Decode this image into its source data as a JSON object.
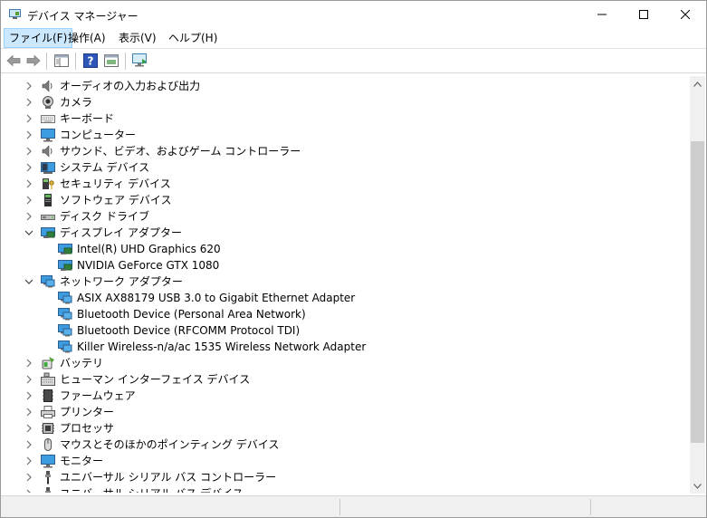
{
  "window": {
    "title": "デバイス マネージャー",
    "minimize_glyph": "—",
    "maximize_glyph": "☐",
    "close_glyph": "✕"
  },
  "menu": [
    {
      "label": "ファイル(F)"
    },
    {
      "label": "操作(A)"
    },
    {
      "label": "表示(V)"
    },
    {
      "label": "ヘルプ(H)"
    }
  ],
  "tree": [
    {
      "label": "オーディオの入力および出力",
      "icon": "speaker-icon",
      "expanded": false,
      "level": 0
    },
    {
      "label": "カメラ",
      "icon": "camera-icon",
      "expanded": false,
      "level": 0
    },
    {
      "label": "キーボード",
      "icon": "keyboard-icon",
      "expanded": false,
      "level": 0
    },
    {
      "label": "コンピューター",
      "icon": "monitor-icon",
      "expanded": false,
      "level": 0
    },
    {
      "label": "サウンド、ビデオ、およびゲーム コントローラー",
      "icon": "speaker-icon",
      "expanded": false,
      "level": 0
    },
    {
      "label": "システム デバイス",
      "icon": "system-device-icon",
      "expanded": false,
      "level": 0
    },
    {
      "label": "セキュリティ デバイス",
      "icon": "security-device-icon",
      "expanded": false,
      "level": 0
    },
    {
      "label": "ソフトウェア デバイス",
      "icon": "software-device-icon",
      "expanded": false,
      "level": 0
    },
    {
      "label": "ディスク ドライブ",
      "icon": "disk-drive-icon",
      "expanded": false,
      "level": 0
    },
    {
      "label": "ディスプレイ アダプター",
      "icon": "display-adapter-icon",
      "expanded": true,
      "level": 0
    },
    {
      "label": "Intel(R) UHD Graphics 620",
      "icon": "display-adapter-icon",
      "level": 1
    },
    {
      "label": "NVIDIA GeForce GTX 1080",
      "icon": "display-adapter-icon",
      "level": 1
    },
    {
      "label": "ネットワーク アダプター",
      "icon": "network-adapter-icon",
      "expanded": true,
      "level": 0
    },
    {
      "label": "ASIX AX88179 USB 3.0 to Gigabit Ethernet Adapter",
      "icon": "network-adapter-icon",
      "level": 1
    },
    {
      "label": "Bluetooth Device (Personal Area Network)",
      "icon": "network-adapter-icon",
      "level": 1
    },
    {
      "label": "Bluetooth Device (RFCOMM Protocol TDI)",
      "icon": "network-adapter-icon",
      "level": 1
    },
    {
      "label": "Killer Wireless-n/a/ac 1535 Wireless Network Adapter",
      "icon": "network-adapter-icon",
      "level": 1
    },
    {
      "label": "バッテリ",
      "icon": "battery-icon",
      "expanded": false,
      "level": 0
    },
    {
      "label": "ヒューマン インターフェイス デバイス",
      "icon": "hid-icon",
      "expanded": false,
      "level": 0
    },
    {
      "label": "ファームウェア",
      "icon": "firmware-icon",
      "expanded": false,
      "level": 0
    },
    {
      "label": "プリンター",
      "icon": "printer-icon",
      "expanded": false,
      "level": 0
    },
    {
      "label": "プロセッサ",
      "icon": "processor-icon",
      "expanded": false,
      "level": 0
    },
    {
      "label": "マウスとそのほかのポインティング デバイス",
      "icon": "mouse-icon",
      "expanded": false,
      "level": 0
    },
    {
      "label": "モニター",
      "icon": "monitor-icon",
      "expanded": false,
      "level": 0
    },
    {
      "label": "ユニバーサル シリアル バス コントローラー",
      "icon": "usb-icon",
      "expanded": false,
      "level": 0
    },
    {
      "label": "ユニバーサル シリアル バス デバイス",
      "icon": "usb-icon",
      "expanded": false,
      "level": 0
    }
  ]
}
